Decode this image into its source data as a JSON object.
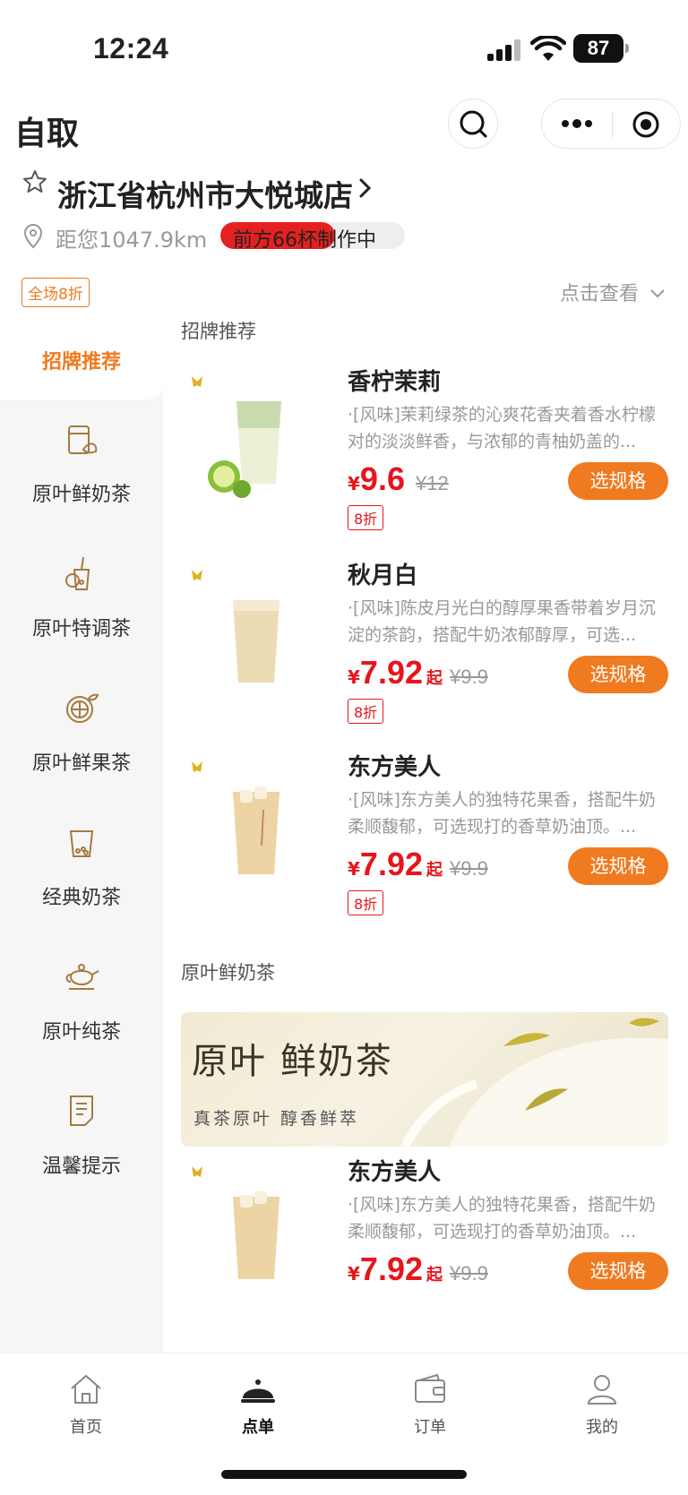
{
  "status_bar": {
    "time": "12:24",
    "battery": "87"
  },
  "header": {
    "title": "自取"
  },
  "store": {
    "name": "浙江省杭州市大悦城店",
    "distance": "距您1047.9km",
    "queue": "前方66杯制作中",
    "queue_progress": 0.62
  },
  "promo": {
    "badge": "全场8折",
    "view": "点击查看"
  },
  "sidebar": {
    "active": "招牌推荐",
    "items": [
      {
        "label": "原叶鲜奶茶",
        "icon": "milk-tea-cup-icon"
      },
      {
        "label": "原叶特调茶",
        "icon": "special-tea-icon"
      },
      {
        "label": "原叶鲜果茶",
        "icon": "lemon-icon"
      },
      {
        "label": "经典奶茶",
        "icon": "boba-cup-icon"
      },
      {
        "label": "原叶纯茶",
        "icon": "teapot-icon"
      },
      {
        "label": "温馨提示",
        "icon": "notice-icon"
      }
    ]
  },
  "sections": [
    {
      "title": "招牌推荐"
    },
    {
      "title": "原叶鲜奶茶"
    }
  ],
  "products": [
    {
      "name": "香柠茉莉",
      "desc": "·[风味]茉莉绿茶的沁爽花香夹着香水柠檬对的淡淡鲜香，与浓郁的青柚奶盖的...",
      "yen": "¥",
      "price": "9.6",
      "qi": "",
      "orig": "¥12",
      "discount": "8折",
      "button": "选规格"
    },
    {
      "name": "秋月白",
      "desc": "·[风味]陈皮月光白的醇厚果香带着岁月沉淀的茶韵，搭配牛奶浓郁醇厚，可选...",
      "yen": "¥",
      "price": "7.92",
      "qi": "起",
      "orig": "¥9.9",
      "discount": "8折",
      "button": "选规格"
    },
    {
      "name": "东方美人",
      "desc": "·[风味]东方美人的独特花果香，搭配牛奶柔顺馥郁，可选现打的香草奶油顶。...",
      "yen": "¥",
      "price": "7.92",
      "qi": "起",
      "orig": "¥9.9",
      "discount": "8折",
      "button": "选规格"
    },
    {
      "name": "东方美人",
      "desc": "·[风味]东方美人的独特花果香，搭配牛奶柔顺馥郁，可选现打的香草奶油顶。...",
      "yen": "¥",
      "price": "7.92",
      "qi": "起",
      "orig": "¥9.9",
      "discount": "",
      "button": "选规格"
    }
  ],
  "banner": {
    "title": "原叶 鲜奶茶",
    "subtitle": "真茶原叶  醇香鲜萃"
  },
  "tabbar": [
    {
      "label": "首页",
      "icon": "home-icon"
    },
    {
      "label": "点单",
      "icon": "cloche-icon",
      "active": true
    },
    {
      "label": "订单",
      "icon": "wallet-icon"
    },
    {
      "label": "我的",
      "icon": "profile-icon"
    }
  ],
  "colors": {
    "accent": "#f07a1f",
    "price": "#e5161d"
  }
}
